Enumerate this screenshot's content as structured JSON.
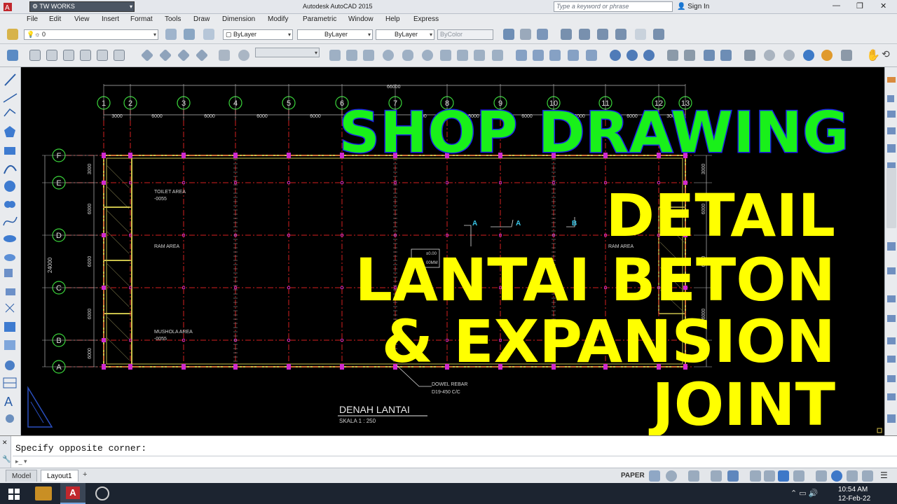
{
  "titlebar": {
    "workspace": "TW WORKS",
    "app_title": "Autodesk AutoCAD 2015",
    "search_placeholder": "Type a keyword or phrase",
    "sign_in": "Sign In"
  },
  "menu": [
    "File",
    "Edit",
    "View",
    "Insert",
    "Format",
    "Tools",
    "Draw",
    "Dimension",
    "Modify",
    "Parametric",
    "Window",
    "Help",
    "Express"
  ],
  "properties_bar": {
    "layer_value": "0",
    "color": "ByLayer",
    "linetype": "ByLayer",
    "lineweight": "ByLayer",
    "plotstyle": "ByColor"
  },
  "drawing": {
    "overall_dim": "66000",
    "grid_columns": [
      "1",
      "2",
      "3",
      "4",
      "5",
      "6",
      "7",
      "8",
      "9",
      "10",
      "11",
      "12",
      "13"
    ],
    "column_spacings": [
      "3000",
      "6000",
      "6000",
      "6000",
      "6000",
      "6000",
      "6000",
      "6000",
      "6000",
      "6000",
      "6000",
      "3000"
    ],
    "grid_rows": [
      "F",
      "E",
      "D",
      "C",
      "B",
      "A"
    ],
    "row_spacings": [
      "3000",
      "6000",
      "6000",
      "6000",
      "6000",
      "3000"
    ],
    "overall_height": "24000",
    "labels": {
      "toilet": "TOILET AREA",
      "toilet_level": "-0055",
      "ram_left": "RAM AREA",
      "ram_right": "RAM AREA",
      "mushola": "MUSHOLA AREA",
      "mushola_level": "-0055",
      "dowel1": "DOWEL REBAR",
      "dowel2": "D19-450 C/C",
      "section_a1": "A",
      "section_a2": "A",
      "section_b": "B",
      "tag1": "±0.00",
      "tag2": "00MM"
    },
    "title": "DENAH LANTAI",
    "scale": "SKALA 1 : 250"
  },
  "overlay": {
    "line1": "SHOP DRAWING",
    "line2": "DETAIL",
    "line3": "LANTAI BETON",
    "line4": "& EXPANSION",
    "line5": "JOINT"
  },
  "command": {
    "history": "Specify opposite corner:",
    "prompt": ""
  },
  "layout_tabs": [
    "Model",
    "Layout1"
  ],
  "status": {
    "space": "PAPER"
  },
  "taskbar": {
    "time": "10:54 AM",
    "date": "12-Feb-22"
  }
}
